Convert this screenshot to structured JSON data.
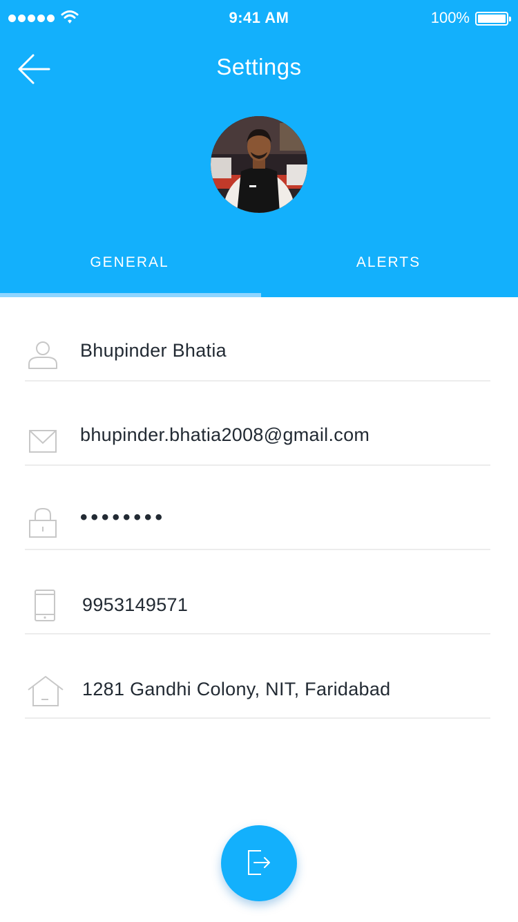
{
  "status_bar": {
    "time": "9:41 AM",
    "battery_percent": "100%",
    "signal_bars": 5,
    "icons": [
      "signal-dots-icon",
      "wifi-icon",
      "battery-icon"
    ]
  },
  "header": {
    "title": "Settings",
    "back_icon": "arrow-left-icon",
    "background_color": "#13b0fc"
  },
  "profile": {
    "avatar": "profile-photo"
  },
  "tabs": [
    {
      "label": "GENERAL",
      "active": true
    },
    {
      "label": "ALERTS",
      "active": false
    }
  ],
  "fields": {
    "name": {
      "icon": "user-icon",
      "value": "Bhupinder Bhatia"
    },
    "email": {
      "icon": "envelope-icon",
      "value": "bhupinder.bhatia2008@gmail.com"
    },
    "password": {
      "icon": "lock-icon",
      "value": "••••••••"
    },
    "phone": {
      "icon": "mobile-phone-icon",
      "value": "9953149571"
    },
    "address": {
      "icon": "home-icon",
      "value": "1281 Gandhi Colony, NIT, Faridabad"
    }
  },
  "logout": {
    "icon": "logout-icon",
    "color": "#13b0fc"
  }
}
